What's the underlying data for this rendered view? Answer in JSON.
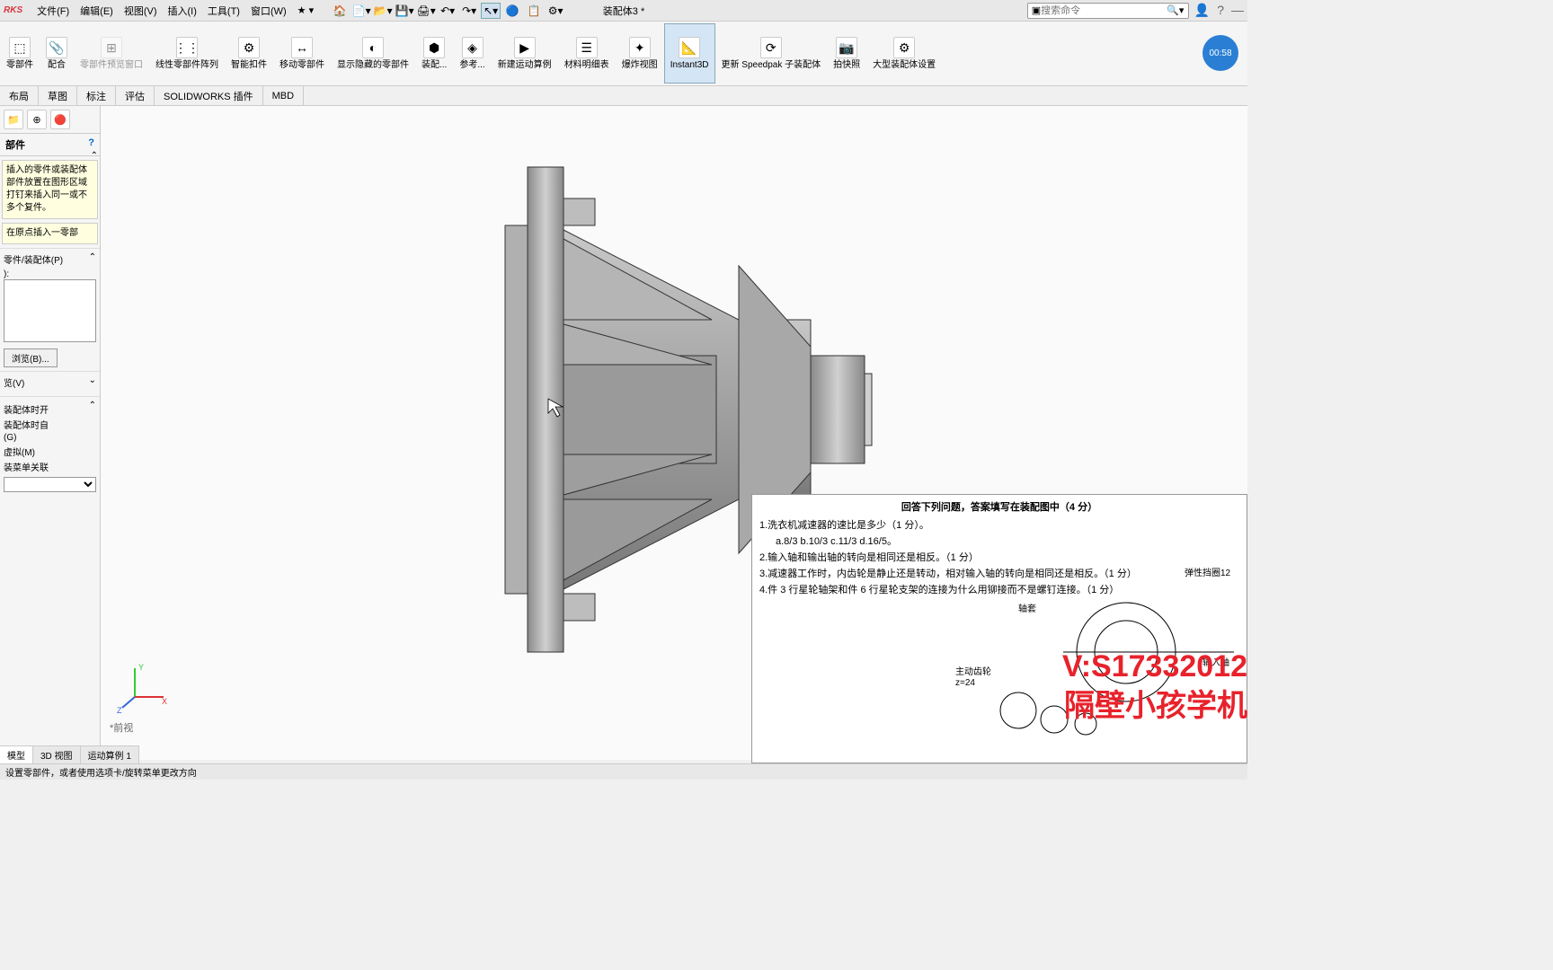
{
  "app": {
    "logo": "RKS",
    "title": "装配体3 *"
  },
  "menus": [
    "文件(F)",
    "编辑(E)",
    "视图(V)",
    "插入(I)",
    "工具(T)",
    "窗口(W)"
  ],
  "search": {
    "placeholder": "搜索命令"
  },
  "ribbon": [
    {
      "label": "零部件",
      "icon": "⬚"
    },
    {
      "label": "配合",
      "icon": "📎"
    },
    {
      "label": "零部件预览窗口",
      "icon": "⊞",
      "disabled": true
    },
    {
      "label": "线性零部件阵列",
      "icon": "⋮⋮"
    },
    {
      "label": "智能扣件",
      "icon": "⚙"
    },
    {
      "label": "移动零部件",
      "icon": "↔"
    },
    {
      "label": "显示隐藏的零部件",
      "icon": "◐"
    },
    {
      "label": "装配...",
      "icon": "⬢"
    },
    {
      "label": "参考...",
      "icon": "◈"
    },
    {
      "label": "新建运动算例",
      "icon": "▶"
    },
    {
      "label": "材料明细表",
      "icon": "☰"
    },
    {
      "label": "爆炸视图",
      "icon": "✦"
    },
    {
      "label": "Instant3D",
      "icon": "📐",
      "active": true
    },
    {
      "label": "更新 Speedpak 子装配体",
      "icon": "⟳"
    },
    {
      "label": "拍快照",
      "icon": "📷"
    },
    {
      "label": "大型装配体设置",
      "icon": "⚙"
    }
  ],
  "timer": "00:58",
  "tabs": [
    "布局",
    "草图",
    "标注",
    "评估",
    "SOLIDWORKS 插件",
    "MBD"
  ],
  "leftPanel": {
    "title": "部件",
    "help1": "插入的零件或装配体部件放置在图形区域打钉来插入同一或不多个复件。",
    "help2": "在原点插入一零部",
    "section1": "零件/装配体(P)",
    "browse": "浏览(B)...",
    "sectionView": "览(V)",
    "opts": [
      "装配体时开",
      "装配体时自",
      "(G)",
      "虚拟(M)",
      "装菜单关联"
    ]
  },
  "bottomTabs": [
    "模型",
    "3D 视图",
    "运动算例 1"
  ],
  "statusbar": "设置零部件，或者使用选项卡/旋转菜单更改方向",
  "frontLabel": "*前视",
  "overlay": {
    "title": "回答下列问题，答案填写在装配图中（4 分）",
    "q1": "1.洗衣机减速器的速比是多少（1 分）。",
    "q1opts": "a.8/3    b.10/3    c.11/3    d.16/5。",
    "q2": "2.输入轴和输出轴的转向是相同还是相反。（1 分）",
    "q3": "3.减速器工作时，内齿轮是静止还是转动，相对输入轴的转向是相同还是相反。（1 分）",
    "q4": "4.件 3 行星轮轴架和件 6 行星轮支架的连接为什么用铆接而不是螺钉连接。（1 分）",
    "labels": {
      "gear": "主动齿轮",
      "gearZ": "z=24",
      "spring": "弹性挡圈12",
      "sleeve": "轴套",
      "input": "输入轴"
    }
  },
  "redText": {
    "line1": "V:S17332012",
    "line2": "隔壁小孩学机"
  }
}
